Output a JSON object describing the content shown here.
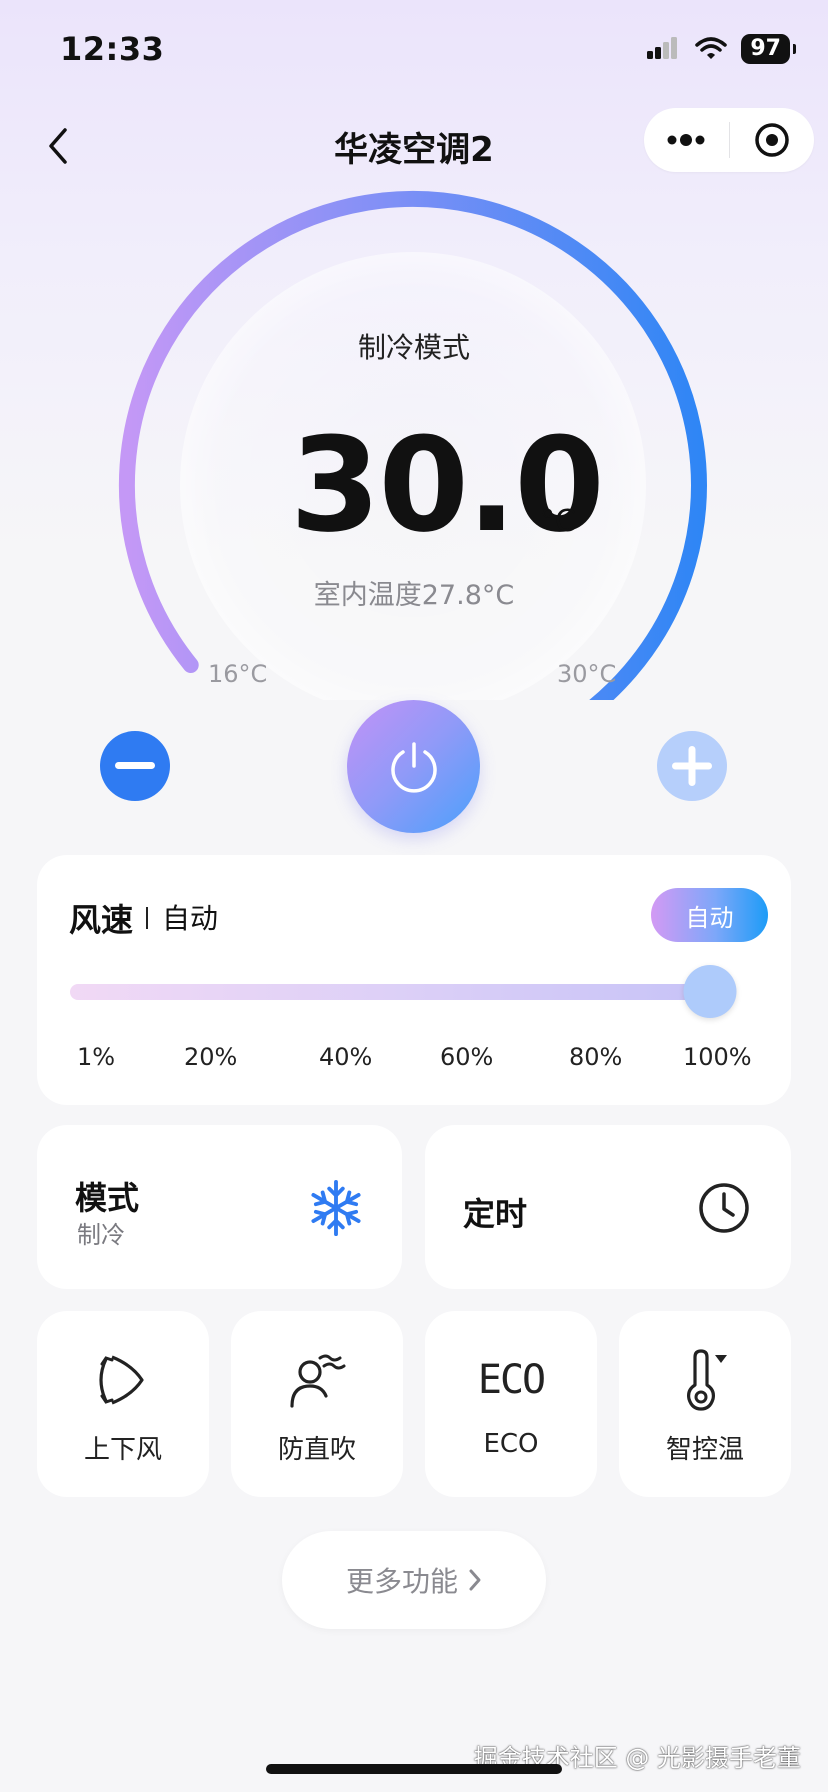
{
  "status_bar": {
    "time": "12:33",
    "battery": "97"
  },
  "nav": {
    "title": "华凌空调2"
  },
  "dial": {
    "mode_label": "制冷模式",
    "temperature": "30.0",
    "unit": "°C",
    "indoor_temp": "室内温度27.8°C",
    "min_label": "16°C",
    "max_label": "30°C",
    "min": 16,
    "max": 30,
    "current": 30.0,
    "gradient_start": "#c498f6",
    "gradient_end": "#2f86f5",
    "knob_color": "#2879f0"
  },
  "fan": {
    "title": "风速",
    "value": "自动",
    "auto_label": "自动",
    "level_percent": 100,
    "ticks": [
      "1%",
      "20%",
      "40%",
      "60%",
      "80%",
      "100%"
    ]
  },
  "mode_card": {
    "title": "模式",
    "subtitle": "制冷",
    "icon": "snowflake-icon"
  },
  "timer_card": {
    "title": "定时",
    "icon": "clock-icon"
  },
  "functions": [
    {
      "label": "上下风",
      "icon": "swing-icon"
    },
    {
      "label": "防直吹",
      "icon": "anti-direct-blow-icon"
    },
    {
      "label": "ECO",
      "icon": "eco-icon",
      "icon_text": "ECO"
    },
    {
      "label": "智控温",
      "icon": "thermometer-icon"
    }
  ],
  "more_button": {
    "label": "更多功能"
  },
  "watermark": "掘金技术社区 @ 光影摄手老董",
  "colors": {
    "accent_blue": "#2f7bf2",
    "light_blue": "#b6cffb",
    "snowflake": "#2f7bf2"
  }
}
